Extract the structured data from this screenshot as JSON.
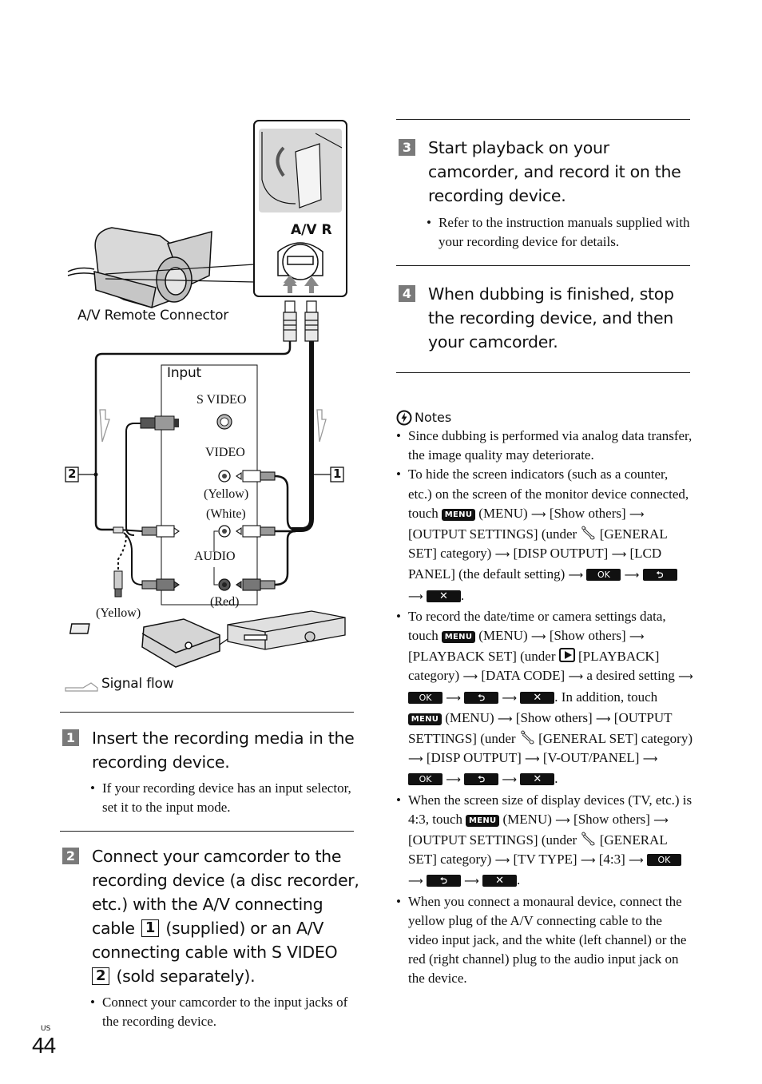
{
  "diagram": {
    "connector_label": "A/V Remote Connector",
    "jack_label": "A/V R",
    "input_label": "Input",
    "s_video_label": "S VIDEO",
    "video_label": "VIDEO",
    "yellow_label": "(Yellow)",
    "white_label": "(White)",
    "audio_label": "AUDIO",
    "red_label": "(Red)",
    "yellow_plug_label": "(Yellow)",
    "cable_1_label": "1",
    "cable_2_label": "2",
    "signal_flow_label": "Signal flow"
  },
  "steps": [
    {
      "number": "1",
      "title": "Insert the recording media in the recording device.",
      "bullet": "If your recording device has an input selector, set it to the input mode."
    },
    {
      "number": "2",
      "title_parts": [
        "Connect your camcorder to the recording device (a disc recorder, etc.) with the A/V connecting cable",
        "1",
        "(supplied) or an A/V connecting cable with S VIDEO",
        "2",
        "(sold separately)."
      ],
      "bullet": "Connect your camcorder to the input jacks of the recording device."
    },
    {
      "number": "3",
      "title": "Start playback on your camcorder, and record it on the recording device.",
      "bullet": "Refer to the instruction manuals supplied with your recording device for details."
    },
    {
      "number": "4",
      "title": "When dubbing is finished, stop the recording device, and then your camcorder."
    }
  ],
  "notes": {
    "heading": "Notes",
    "items": {
      "n1": "Since dubbing is performed via analog data transfer, the image quality may deteriorate.",
      "n2": {
        "a": "To hide the screen indicators (such as a counter, etc.) on the screen of the monitor device connected, touch",
        "b": "(MENU)",
        "c": "[Show others]",
        "d": "[OUTPUT SETTINGS] (under",
        "e": "[GENERAL SET] category)",
        "f": "[DISP OUTPUT]",
        "g": "[LCD PANEL] (the default setting)"
      },
      "n3": {
        "a": "To record the date/time or camera settings data, touch",
        "b": "(MENU)",
        "c": "[Show others]",
        "d": "[PLAYBACK SET] (under",
        "e": "[PLAYBACK] category)",
        "f": "[DATA CODE]",
        "g": "a desired setting",
        "h": ". In addition, touch",
        "i": "(MENU)",
        "j": "[Show others]",
        "k": "[OUTPUT SETTINGS] (under",
        "l": "[GENERAL SET] category)",
        "m": "[DISP OUTPUT]",
        "n": "[V-OUT/PANEL]"
      },
      "n4": {
        "a": "When the screen size of display devices (TV, etc.) is 4:3, touch",
        "b": "(MENU)",
        "c": "[Show others]",
        "d": "[OUTPUT SETTINGS] (under",
        "e": "[GENERAL SET] category)",
        "f": "[TV TYPE]",
        "g": "[4:3]"
      },
      "n5": "When you connect a monaural device, connect the yellow plug of the A/V connecting cable to the video input jack, and the white (left channel) or the red (right channel) plug to the audio input jack on the device."
    }
  },
  "buttons": {
    "menu": "MENU",
    "ok": "OK",
    "back": "⮌",
    "close": "✕"
  },
  "symbols": {
    "arrow": "⟶",
    "bullet": "•",
    "period": "."
  },
  "footer": {
    "region": "US",
    "page_number": "44"
  }
}
